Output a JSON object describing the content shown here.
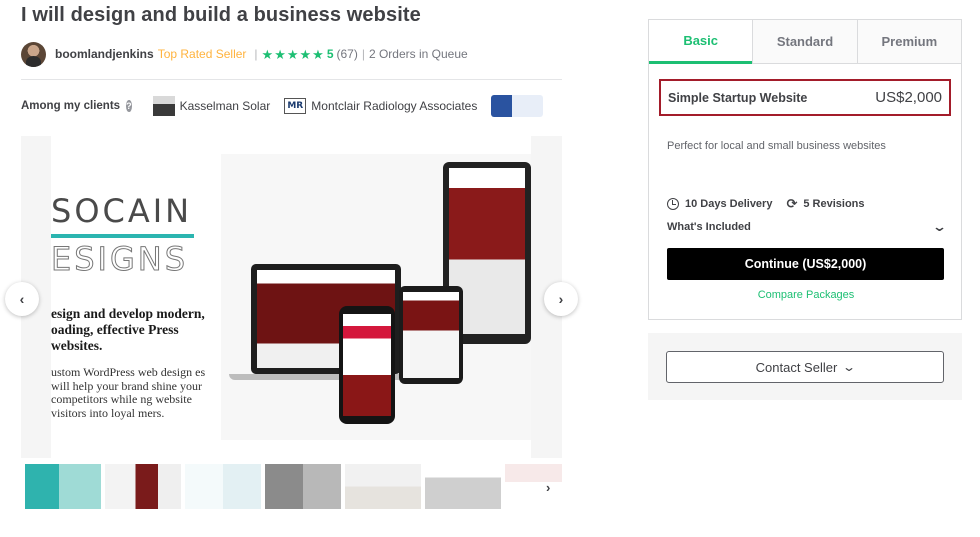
{
  "gig": {
    "title": "I will design and build a business website"
  },
  "seller": {
    "name": "boomlandjenkins",
    "level": "Top Rated Seller",
    "rating": "5",
    "review_count": "(67)",
    "orders_in_queue": "2 Orders in Queue",
    "stars": 5
  },
  "clients": {
    "label": "Among my clients",
    "items": [
      {
        "name": "Kasselman Solar",
        "logo": "kasselman-solar-logo"
      },
      {
        "name": "Montclair Radiology Associates",
        "logo": "montclair-radiology-logo",
        "logo_text": "MR"
      },
      {
        "name": "",
        "logo": "philippine-logo"
      }
    ]
  },
  "gallery": {
    "slide": {
      "brand_line1": "SOCAIN",
      "brand_line2": "ESIGNS",
      "headline": "esign and develop modern, oading, effective Press websites.",
      "body": "ustom WordPress web design es will help your brand shine your competitors while ng website visitors into loyal mers."
    },
    "thumbnail_count": 7
  },
  "packages": {
    "tabs": [
      {
        "label": "Basic",
        "active": true
      },
      {
        "label": "Standard",
        "active": false
      },
      {
        "label": "Premium",
        "active": false
      }
    ],
    "selected": {
      "name": "Simple Startup Website",
      "price": "US$2,000",
      "description": "Perfect for local and small business websites",
      "delivery": "10 Days Delivery",
      "revisions": "5 Revisions",
      "included_label": "What's Included",
      "continue_label": "Continue (US$2,000)",
      "compare_label": "Compare Packages"
    }
  },
  "contact": {
    "label": "Contact Seller"
  },
  "colors": {
    "accent": "#1dbf73",
    "top_rated": "#ffb33e",
    "highlight_border": "#a31c2a",
    "button_bg": "#000000"
  }
}
